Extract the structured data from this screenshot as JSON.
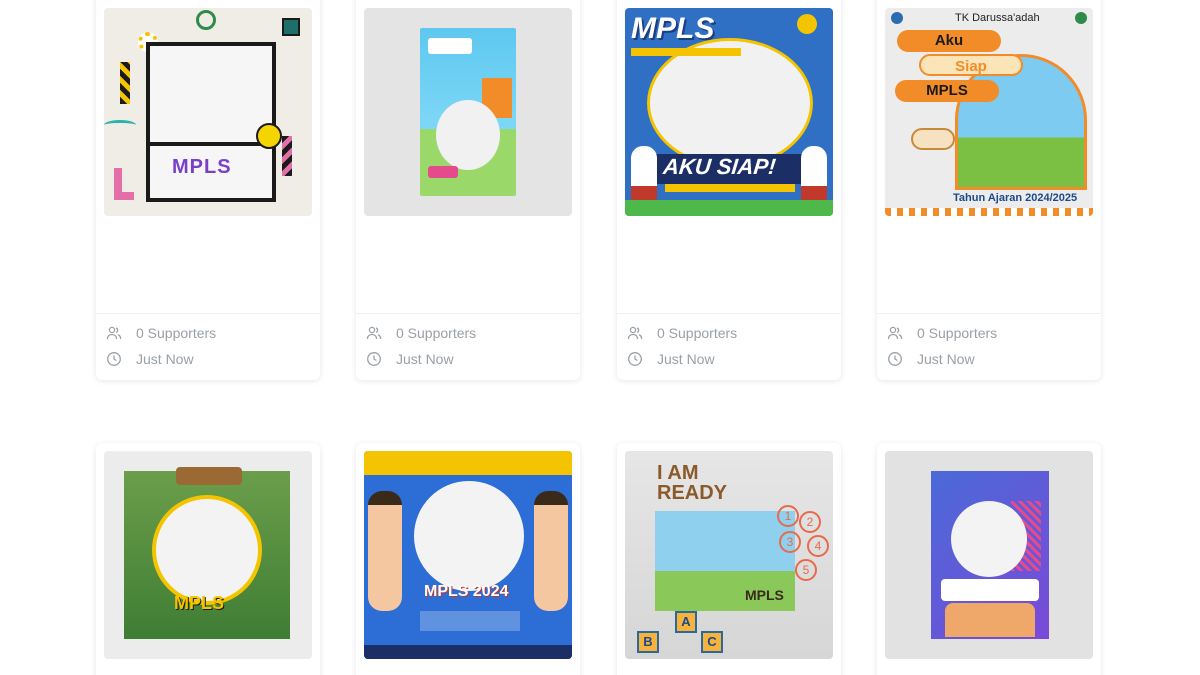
{
  "cards": [
    {
      "id": 1,
      "frame_text": "MPLS",
      "supporters_label": "0 Supporters",
      "time_label": "Just Now"
    },
    {
      "id": 2,
      "frame_text": "",
      "supporters_label": "0 Supporters",
      "time_label": "Just Now"
    },
    {
      "id": 3,
      "frame_text": "MPLS",
      "frame_banner": "AKU SIAP!",
      "supporters_label": "0 Supporters",
      "time_label": "Just Now"
    },
    {
      "id": 4,
      "frame_school": "TK Darussa'adah",
      "frame_pills": [
        "Aku",
        "Siap",
        "MPLS"
      ],
      "frame_year": "Tahun Ajaran 2024/2025",
      "supporters_label": "0 Supporters",
      "time_label": "Just Now"
    },
    {
      "id": 5,
      "frame_text": "MPLS"
    },
    {
      "id": 6,
      "frame_text": "MPLS 2024"
    },
    {
      "id": 7,
      "frame_text_1": "I AM",
      "frame_text_2": "READY",
      "frame_text_3": "MPLS",
      "numbers": [
        "1",
        "2",
        "3",
        "4",
        "5"
      ],
      "blocks": [
        "B",
        "A",
        "C"
      ]
    },
    {
      "id": 8,
      "frame_text": ""
    }
  ],
  "icons": {
    "supporters": "users-icon",
    "time": "clock-icon"
  },
  "colors": {
    "meta_text": "#9aa0a6",
    "card_bg": "#ffffff",
    "page_bg": "#ffffff"
  }
}
